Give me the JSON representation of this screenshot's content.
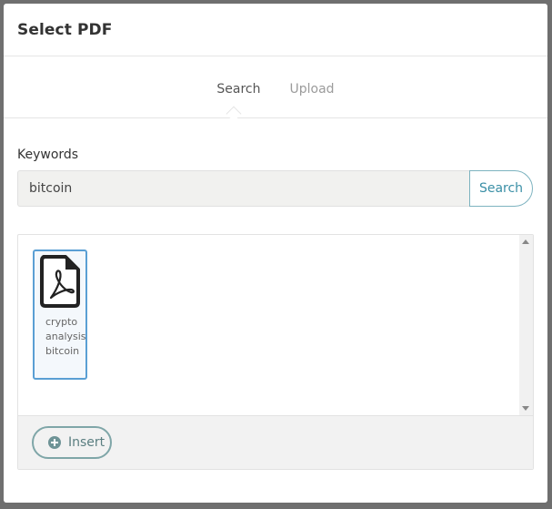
{
  "dialog": {
    "title": "Select PDF"
  },
  "tabs": [
    {
      "label": "Search",
      "active": true
    },
    {
      "label": "Upload",
      "active": false
    }
  ],
  "search": {
    "label": "Keywords",
    "value": "bitcoin",
    "button_label": "Search"
  },
  "results": {
    "files": [
      {
        "name_lines": [
          "crypto",
          "analysis",
          "bitcoin"
        ],
        "icon": "pdf-file-icon",
        "selected": true
      }
    ]
  },
  "footer": {
    "insert_label": "Insert"
  },
  "colors": {
    "accent": "#3a8fa6",
    "selection": "#5a9fd4",
    "insert": "#6e9396"
  }
}
